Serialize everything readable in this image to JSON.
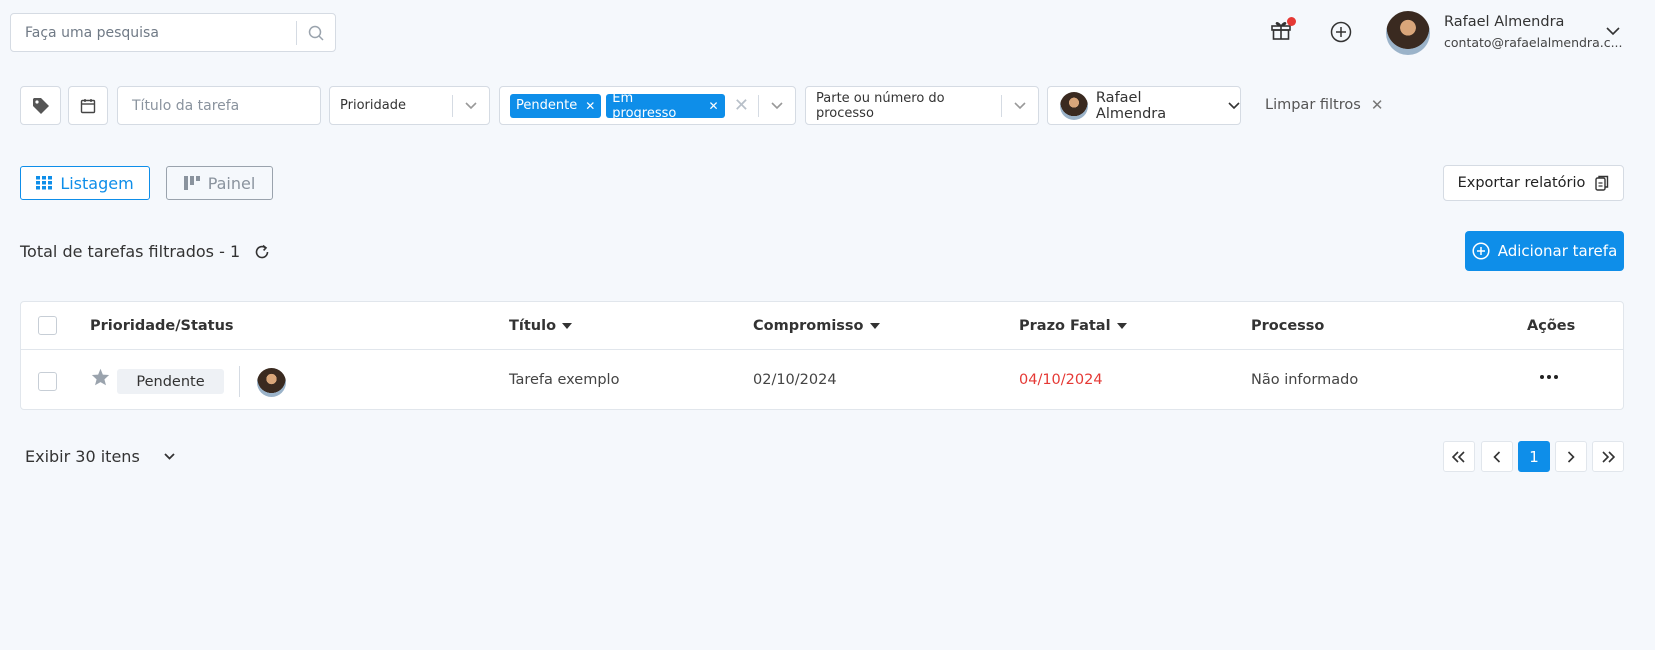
{
  "search": {
    "placeholder": "Faça uma pesquisa"
  },
  "user": {
    "name": "Rafael Almendra",
    "email": "contato@rafaelalmendra.c..."
  },
  "filters": {
    "title_placeholder": "Título da tarefa",
    "priority_placeholder": "Prioridade",
    "status_chips": [
      "Pendente",
      "Em progresso"
    ],
    "process_placeholder": "Parte ou número do processo",
    "responsible": "Rafael Almendra",
    "clear_label": "Limpar filtros"
  },
  "views": {
    "list_label": "Listagem",
    "panel_label": "Painel",
    "active": "Listagem"
  },
  "export_label": "Exportar relatório",
  "total_label": "Total de tarefas filtrados - 1",
  "add_label": "Adicionar tarefa",
  "table": {
    "headers": {
      "priority_status": "Prioridade/Status",
      "title": "Título",
      "commitment": "Compromisso",
      "deadline": "Prazo Fatal",
      "process": "Processo",
      "actions": "Ações"
    },
    "rows": [
      {
        "status": "Pendente",
        "title": "Tarefa exemplo",
        "commitment": "02/10/2024",
        "deadline": "04/10/2024",
        "process": "Não informado"
      }
    ]
  },
  "pagination": {
    "show_label": "Exibir 30 itens",
    "current_page": "1"
  },
  "colors": {
    "accent": "#0e8ee9",
    "deadline": "#e53935",
    "notification": "#e53935"
  }
}
